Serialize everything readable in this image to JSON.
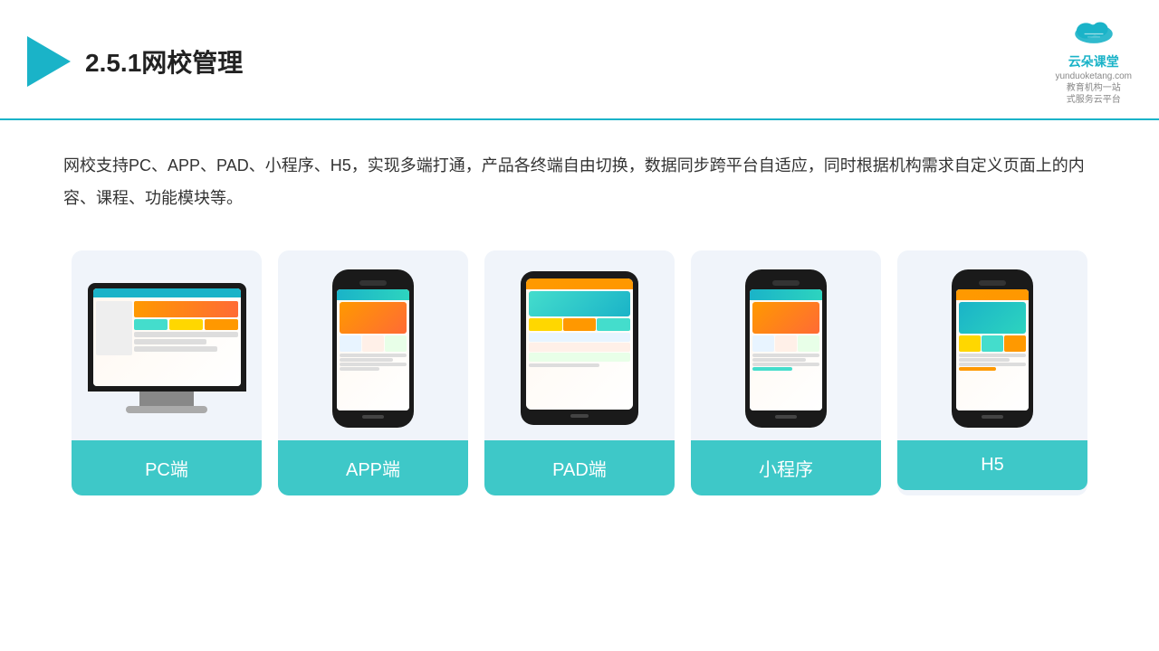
{
  "header": {
    "title": "2.5.1网校管理",
    "brand": {
      "name": "云朵课堂",
      "domain": "yunduoketang.com",
      "tagline": "教育机构一站\n式服务云平台"
    }
  },
  "description": "网校支持PC、APP、PAD、小程序、H5，实现多端打通，产品各终端自由切换，数据同步跨平台自适应，同时根据机构需求自定义页面上的内容、课程、功能模块等。",
  "cards": [
    {
      "id": "pc",
      "label": "PC端",
      "device": "pc"
    },
    {
      "id": "app",
      "label": "APP端",
      "device": "phone"
    },
    {
      "id": "pad",
      "label": "PAD端",
      "device": "tablet"
    },
    {
      "id": "miniapp",
      "label": "小程序",
      "device": "phone"
    },
    {
      "id": "h5",
      "label": "H5",
      "device": "phone"
    }
  ]
}
